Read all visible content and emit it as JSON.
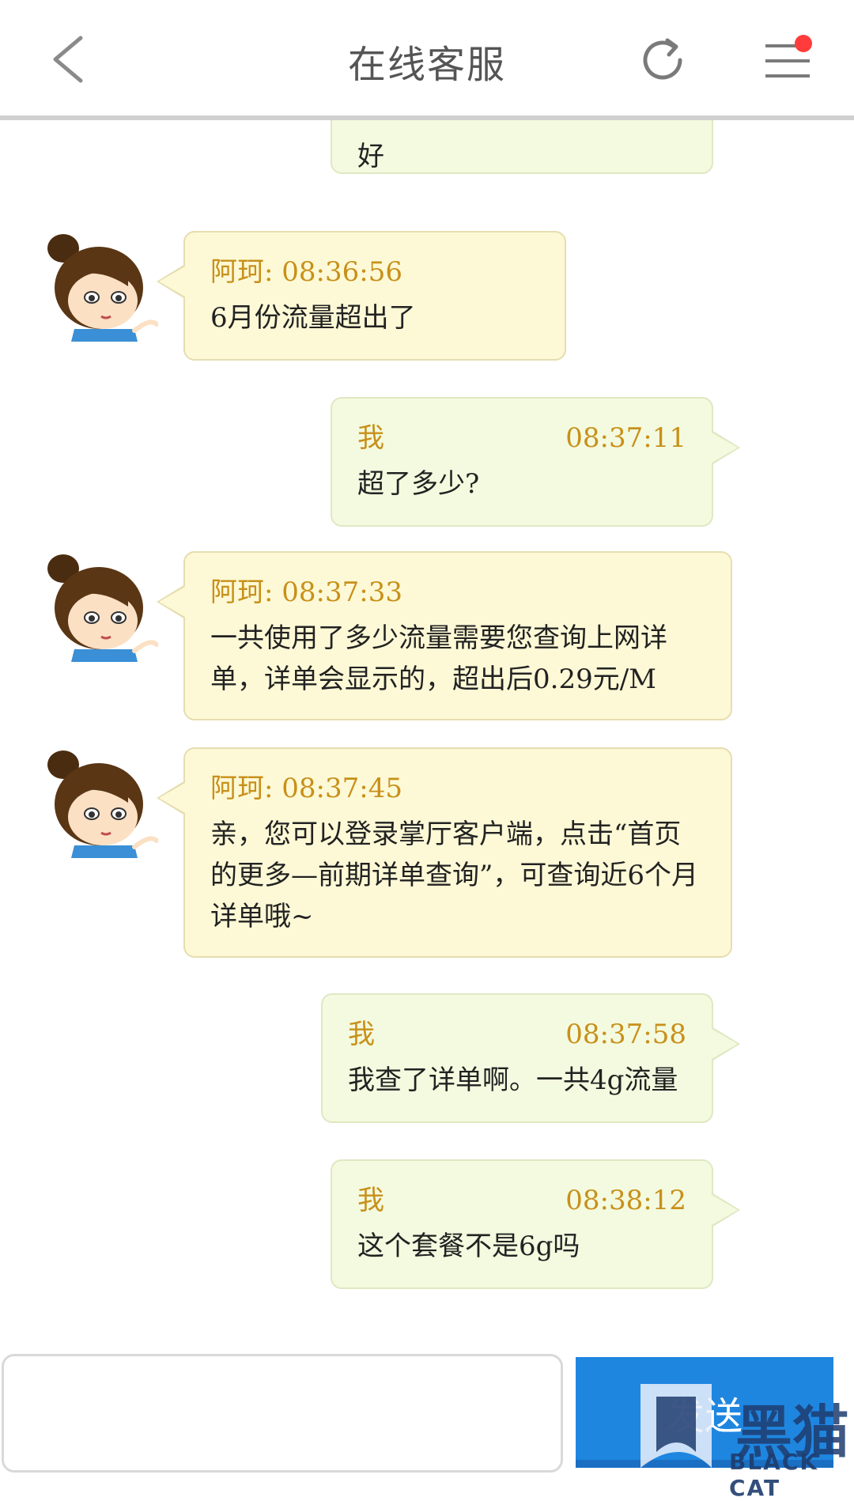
{
  "header": {
    "title": "在线客服",
    "back_icon": "chevron-left-icon",
    "refresh_icon": "refresh-icon",
    "menu_icon": "menu-icon",
    "notification_color": "#ff3b3b"
  },
  "chat": {
    "partial_top_text": "好",
    "messages": [
      {
        "sender": "阿珂:",
        "time": "08:36:56",
        "text": "6月份流量超出了",
        "side": "agent"
      },
      {
        "sender": "我",
        "time": "08:37:11",
        "text": "超了多少?",
        "side": "me"
      },
      {
        "sender": "阿珂:",
        "time": "08:37:33",
        "text": "一共使用了多少流量需要您查询上网详单，详单会显示的，超出后0.29元/M",
        "side": "agent"
      },
      {
        "sender": "阿珂:",
        "time": "08:37:45",
        "text": "亲，您可以登录掌厅客户端，点击“首页的更多—前期详单查询”，可查询近6个月详单哦~",
        "side": "agent"
      },
      {
        "sender": "我",
        "time": "08:37:58",
        "text": "我查了详单啊。一共4g流量",
        "side": "me"
      },
      {
        "sender": "我",
        "time": "08:38:12",
        "text": "这个套餐不是6g吗",
        "side": "me"
      }
    ]
  },
  "composer": {
    "placeholder": "",
    "send_label": "发送"
  },
  "watermark": {
    "text": "黑猫",
    "subtext": "BLACK CAT"
  },
  "colors": {
    "agent_bubble": "#fdf9d6",
    "me_bubble": "#f3fadf",
    "meta_text": "#c8901a",
    "send_button": "#1f86e0"
  }
}
